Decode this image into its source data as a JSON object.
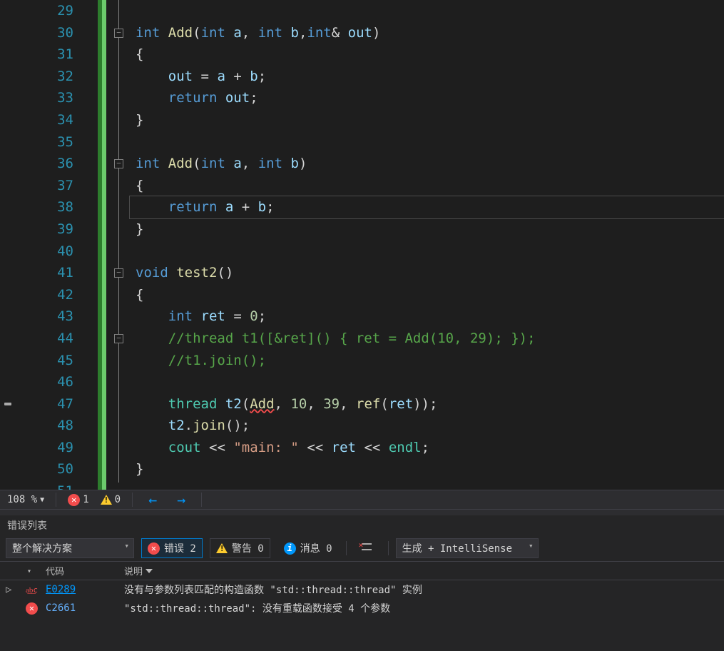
{
  "editor": {
    "first_line": 29,
    "current_line": 38,
    "lines": [
      "",
      "int Add(int a, int b,int& out)",
      "{",
      "    out = a + b;",
      "    return out;",
      "}",
      "",
      "int Add(int a, int b)",
      "{",
      "    return a + b;",
      "}",
      "",
      "void test2()",
      "{",
      "    int ret = 0;",
      "    //thread t1([&ret]() { ret = Add(10, 29); });",
      "    //t1.join();",
      "",
      "    thread t2(Add, 10, 39, ref(ret));",
      "    t2.join();",
      "    cout << \"main: \" << ret << endl;",
      "}",
      ""
    ],
    "folds": [
      {
        "line": 30
      },
      {
        "line": 36
      },
      {
        "line": 41
      },
      {
        "line": 44
      }
    ],
    "breakpoint_margin_marker_line": 47
  },
  "status": {
    "zoom": "108 %",
    "errors": "1",
    "warnings": "0"
  },
  "error_panel": {
    "title": "错误列表",
    "scope_dd": "整个解决方案",
    "btn_errors": "错误 2",
    "btn_warnings": "警告 0",
    "btn_messages": "消息 0",
    "source_dd": "生成 + IntelliSense",
    "cols": {
      "code": "代码",
      "desc": "说明"
    },
    "rows": [
      {
        "severity": "intellisense",
        "code": "E0289",
        "desc": "没有与参数列表匹配的构造函数 \"std::thread::thread\" 实例",
        "link": true,
        "expand": true
      },
      {
        "severity": "error",
        "code": "C2661",
        "desc": "\"std::thread::thread\": 没有重载函数接受 4 个参数",
        "link": false,
        "expand": false
      }
    ]
  }
}
